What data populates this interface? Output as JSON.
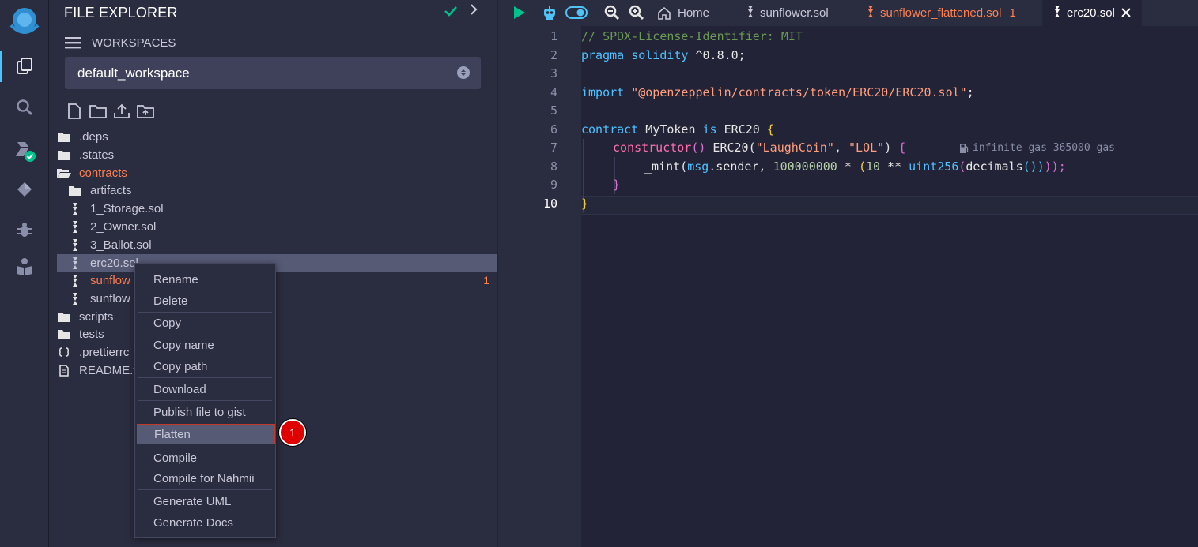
{
  "panel": {
    "title": "FILE EXPLORER",
    "workspaces_label": "WORKSPACES",
    "workspace_selected": "default_workspace"
  },
  "tree": [
    {
      "label": ".deps",
      "type": "folder"
    },
    {
      "label": ".states",
      "type": "folder"
    },
    {
      "label": "contracts",
      "type": "folder-open"
    },
    {
      "label": "artifacts",
      "type": "folder"
    },
    {
      "label": "1_Storage.sol",
      "type": "sol"
    },
    {
      "label": "2_Owner.sol",
      "type": "sol"
    },
    {
      "label": "3_Ballot.sol",
      "type": "sol"
    },
    {
      "label": "erc20.sol",
      "type": "sol",
      "selected": true
    },
    {
      "label": "sunflow",
      "type": "sol",
      "warning": true,
      "badge": "1"
    },
    {
      "label": "sunflow",
      "type": "sol"
    },
    {
      "label": "scripts",
      "type": "folder"
    },
    {
      "label": "tests",
      "type": "folder"
    },
    {
      "label": ".prettierrc",
      "type": "config"
    },
    {
      "label": "README.t",
      "type": "doc"
    }
  ],
  "context_menu": [
    "Rename",
    "Delete",
    "Copy",
    "Copy name",
    "Copy path",
    "Download",
    "Publish file to gist",
    "Flatten",
    "Compile",
    "Compile for Nahmii",
    "Generate UML",
    "Generate Docs"
  ],
  "callout_number": "1",
  "editor_tabs": {
    "home": "Home",
    "tab1": "sunflower.sol",
    "tab2": "sunflower_flattened.sol",
    "tab2_badge": "1",
    "tab3": "erc20.sol"
  },
  "line_numbers": [
    "1",
    "2",
    "3",
    "4",
    "5",
    "6",
    "7",
    "8",
    "9",
    "10"
  ],
  "code": {
    "l1": "// SPDX-License-Identifier: MIT",
    "l2_kw": "pragma solidity",
    "l2_ver": " ^0.8.0;",
    "l4_kw": "import",
    "l4_str": "\"@openzeppelin/contracts/token/ERC20/ERC20.sol\"",
    "l4_end": ";",
    "l6_kw": "contract",
    "l6_name": " MyToken ",
    "l6_is": "is",
    "l6_base": " ERC20 ",
    "l6_brace": "{",
    "l7_fn": "constructor",
    "l7_paren": "()",
    "l7_base": " ERC20(",
    "l7_s1": "\"LaughCoin\"",
    "l7_comma": ", ",
    "l7_s2": "\"LOL\"",
    "l7_close": ") ",
    "l7_brace": "{",
    "l8_mint": "_mint(",
    "l8_msg": "msg",
    "l8_sender": ".sender, ",
    "l8_num": "100000000",
    "l8_mul": " * ",
    "l8_p": "(",
    "l8_ten": "10",
    "l8_pow": " ** ",
    "l8_uint": "uint256",
    "l8_p2": "(",
    "l8_dec": "decimals",
    "l8_p3": "())",
    "l8_end": "));",
    "l9": "}",
    "l10": "}",
    "gas": "infinite gas 365000 gas"
  }
}
